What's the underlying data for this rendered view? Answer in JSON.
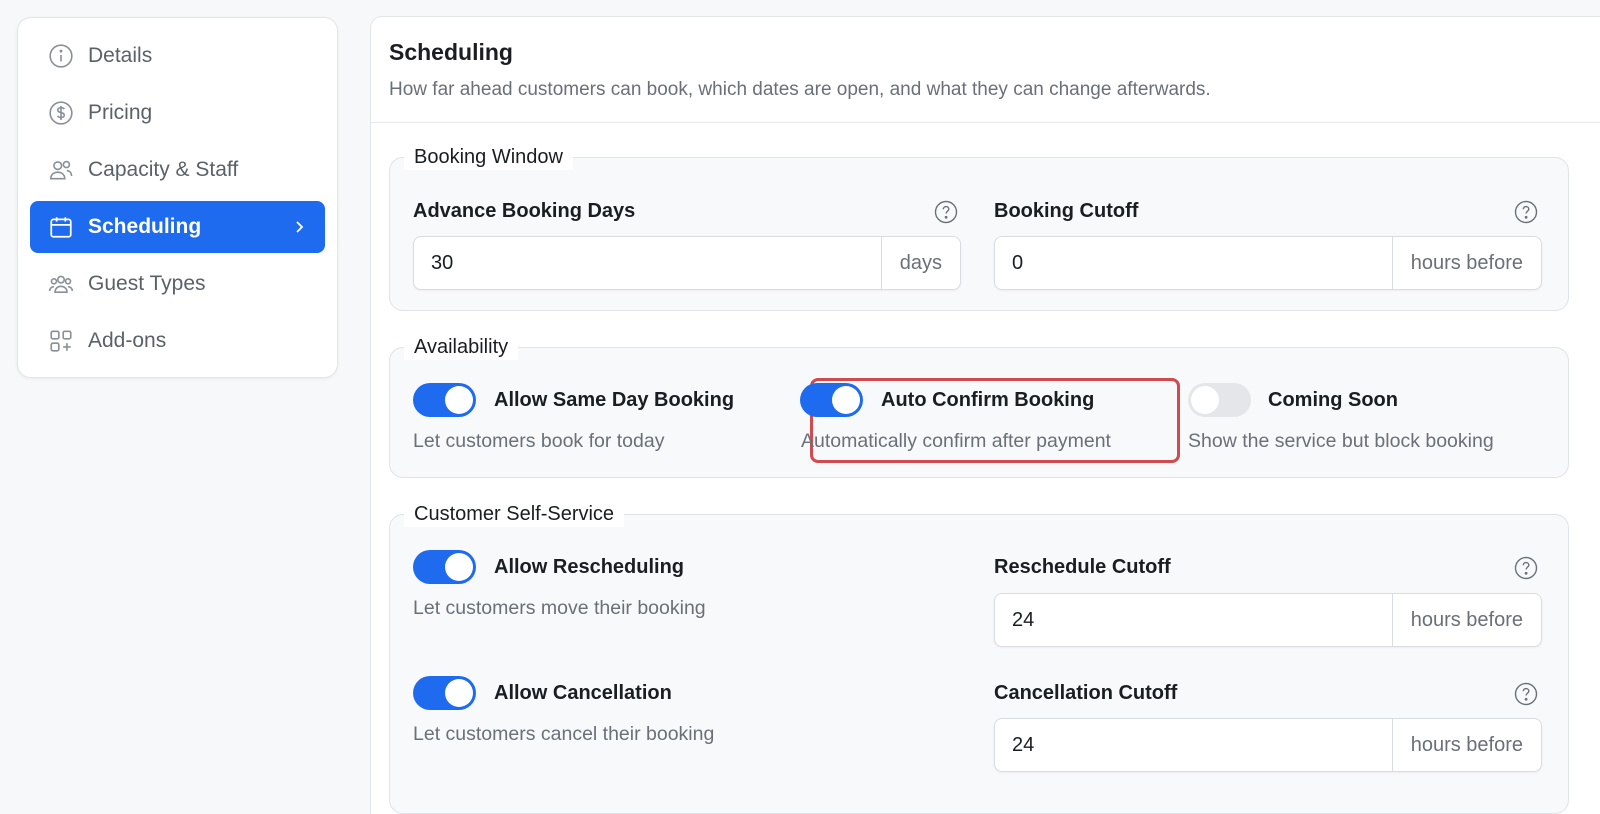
{
  "sidebar": {
    "items": [
      {
        "label": "Details",
        "icon": "info-circle-icon"
      },
      {
        "label": "Pricing",
        "icon": "dollar-circle-icon"
      },
      {
        "label": "Capacity & Staff",
        "icon": "users-icon"
      },
      {
        "label": "Scheduling",
        "icon": "calendar-icon",
        "active": true
      },
      {
        "label": "Guest Types",
        "icon": "group-icon"
      },
      {
        "label": "Add-ons",
        "icon": "grid-plus-icon"
      }
    ]
  },
  "header": {
    "title": "Scheduling",
    "subtitle": "How far ahead customers can book, which dates are open, and what they can change afterwards."
  },
  "booking_window": {
    "legend": "Booking Window",
    "advance_days": {
      "label": "Advance Booking Days",
      "value": "30",
      "suffix": "days"
    },
    "cutoff": {
      "label": "Booking Cutoff",
      "value": "0",
      "suffix": "hours before"
    }
  },
  "availability": {
    "legend": "Availability",
    "same_day": {
      "label": "Allow Same Day Booking",
      "desc": "Let customers book for today",
      "on": true
    },
    "auto_confirm": {
      "label": "Auto Confirm Booking",
      "desc": "Automatically confirm after payment",
      "on": true
    },
    "coming_soon": {
      "label": "Coming Soon",
      "desc": "Show the service but block booking",
      "on": false
    }
  },
  "self_service": {
    "legend": "Customer Self-Service",
    "reschedule": {
      "label": "Allow Rescheduling",
      "desc": "Let customers move their booking",
      "on": true
    },
    "reschedule_cutoff": {
      "label": "Reschedule Cutoff",
      "value": "24",
      "suffix": "hours before"
    },
    "cancellation": {
      "label": "Allow Cancellation",
      "desc": "Let customers cancel their booking",
      "on": true
    },
    "cancellation_cutoff": {
      "label": "Cancellation Cutoff",
      "value": "24",
      "suffix": "hours before"
    }
  },
  "colors": {
    "accent": "#1f6bf0",
    "highlight": "#d14a4f"
  }
}
